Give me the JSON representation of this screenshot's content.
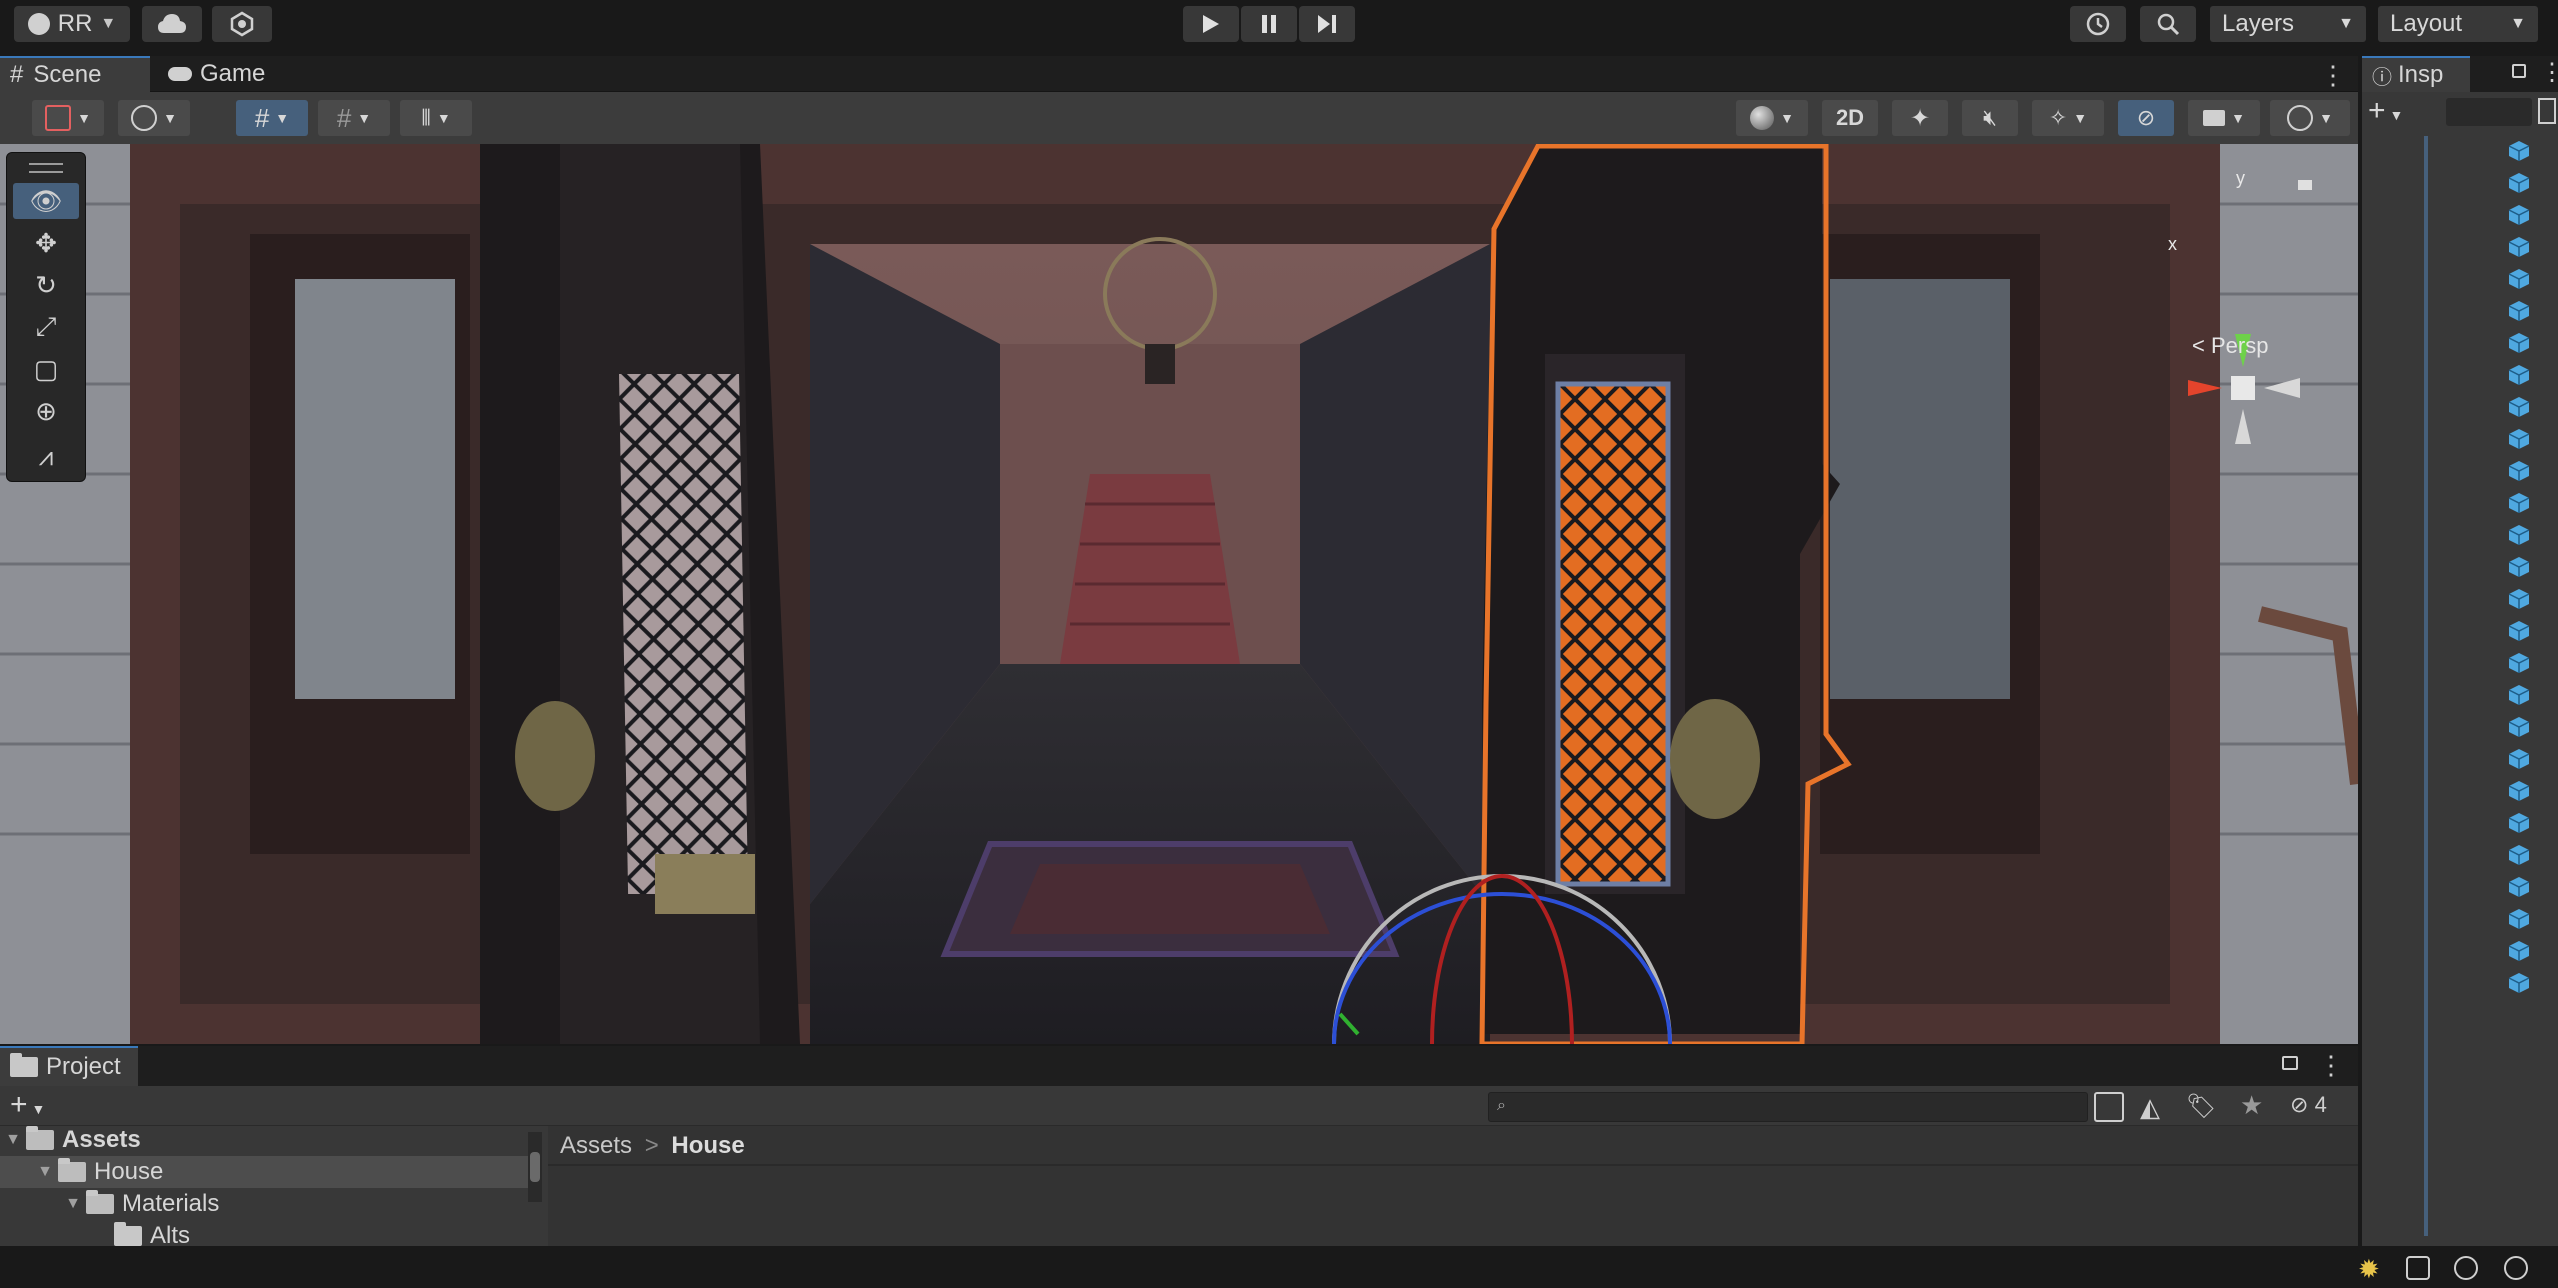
{
  "toolbar": {
    "account": "RR",
    "layers": "Layers",
    "layout": "Layout"
  },
  "tabs": {
    "scene": "Scene",
    "game": "Game",
    "inspector": "Insp"
  },
  "scene_toolbar": {
    "mode_2d": "2D"
  },
  "gizmo": {
    "y_label": "y",
    "x_label": "x",
    "persp_label": "< Persp"
  },
  "project": {
    "tab_label": "Project",
    "breadcrumb_root": "Assets",
    "breadcrumb_sep": ">",
    "breadcrumb_current": "House",
    "hidden_count": "4",
    "tree": [
      {
        "label": "Assets"
      },
      {
        "label": "House"
      },
      {
        "label": "Materials"
      },
      {
        "label": "Alts"
      }
    ]
  },
  "colors": {
    "selection_outline": "#e8742a",
    "accent_blue": "#46607c"
  }
}
